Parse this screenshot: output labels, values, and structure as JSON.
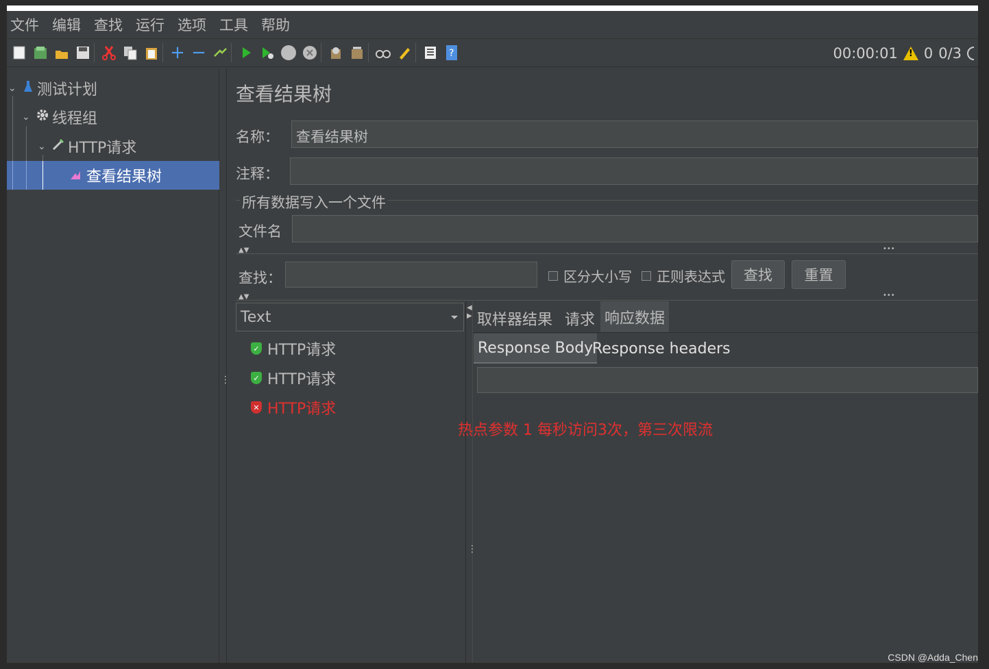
{
  "menu": [
    "文件",
    "编辑",
    "查找",
    "运行",
    "选项",
    "工具",
    "帮助"
  ],
  "toolbar": {
    "icons": [
      "new-icon",
      "templates-icon",
      "open-icon",
      "save-icon",
      "cut-icon",
      "copy-icon",
      "paste-icon",
      "expand-icon",
      "collapse-icon",
      "toggle-icon",
      "start-icon",
      "start-no-pause-icon",
      "stop-icon",
      "shutdown-icon",
      "clear-icon",
      "clear-all-icon",
      "search-icon",
      "reset-search-icon",
      "function-helper-icon",
      "help-icon"
    ],
    "timer": "00:00:01",
    "warnings": "0",
    "threads": "0/3"
  },
  "tree": {
    "items": [
      {
        "label": "测试计划",
        "icon": "test-plan-icon"
      },
      {
        "label": "线程组",
        "icon": "gear-icon"
      },
      {
        "label": "HTTP请求",
        "icon": "pipette-icon"
      },
      {
        "label": "查看结果树",
        "icon": "chart-icon"
      }
    ]
  },
  "panel": {
    "title": "查看结果树",
    "name_label": "名称：",
    "name_value": "查看结果树",
    "comment_label": "注释：",
    "comment_value": "",
    "file_group": "所有数据写入一个文件",
    "filename_label": "文件名",
    "filename_value": "",
    "search_label": "查找：",
    "search_value": "",
    "case_sensitive": "区分大小写",
    "regex": "正则表达式",
    "find_button": "查找",
    "reset_button": "重置",
    "renderer": "Text",
    "results": [
      {
        "label": "HTTP请求",
        "status": "success"
      },
      {
        "label": "HTTP请求",
        "status": "success"
      },
      {
        "label": "HTTP请求",
        "status": "error"
      }
    ],
    "tabs": [
      "取样器结果",
      "请求",
      "响应数据"
    ],
    "active_tab": "响应数据",
    "subtabs": [
      "Response Body",
      "Response headers"
    ],
    "response_body": ""
  },
  "annotation": "热点参数 1 每秒访问3次，第三次限流",
  "watermark": "CSDN @Adda_Chen",
  "colors": {
    "success": "#3cb043",
    "error": "#e03030",
    "selection": "#4b6eaf"
  }
}
